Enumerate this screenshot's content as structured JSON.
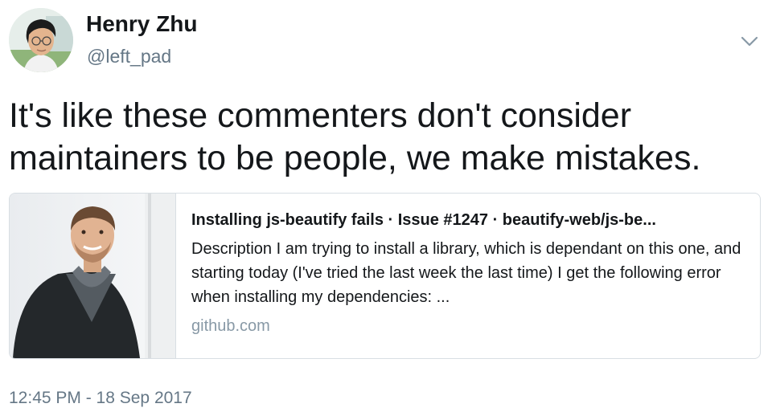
{
  "author": {
    "name": "Henry Zhu",
    "handle": "@left_pad"
  },
  "icons": {
    "menu": "chevron-down-icon"
  },
  "tweet": {
    "text": "It's like these commenters don't consider maintainers to be people, we make mistakes.",
    "timestamp": "12:45 PM - 18 Sep 2017"
  },
  "card": {
    "title": "Installing js-beautify fails · Issue #1247 · beautify-web/js-be...",
    "description": "Description I am trying to install a library, which is dependant on this one, and starting today (I've tried the last week the last time) I get the following error when installing my dependencies: ...",
    "domain": "github.com"
  },
  "colors": {
    "text": "#14171a",
    "secondary": "#657786",
    "domain": "#8899a6",
    "border": "#d8dee3"
  }
}
